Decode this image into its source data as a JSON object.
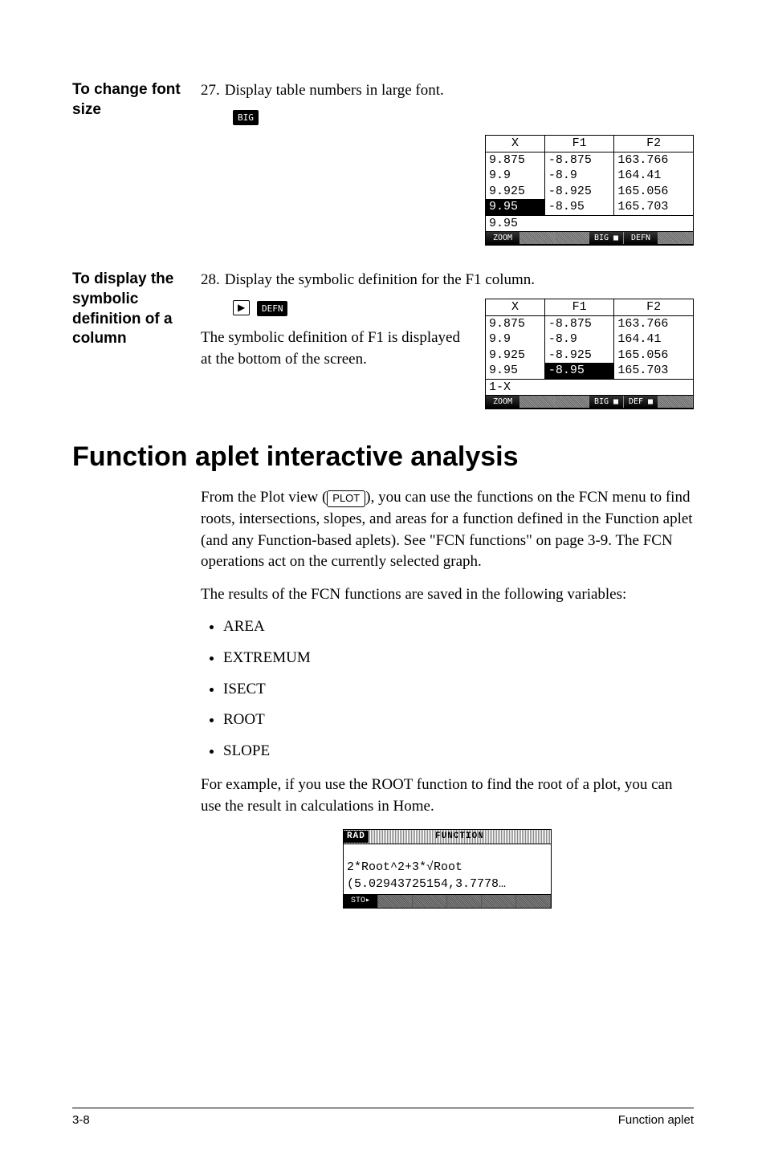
{
  "section1": {
    "heading": "To change font size",
    "step_num": "27.",
    "step_text": "Display table numbers in large font.",
    "softkey": "BIG",
    "table": {
      "headers": [
        "X",
        "F1",
        "F2"
      ],
      "rows": [
        [
          "9.875",
          "-8.875",
          "163.766"
        ],
        [
          "9.9",
          "-8.9",
          "164.41"
        ],
        [
          "9.925",
          "-8.925",
          "165.056"
        ],
        [
          "9.95",
          "-8.95",
          "165.703"
        ]
      ],
      "highlight_row": 3,
      "highlight_col": 0,
      "input_row": "9.95",
      "softkeys": [
        "ZOOM",
        "",
        "",
        "BIG ■",
        "DEFN",
        ""
      ]
    }
  },
  "section2": {
    "heading": "To display the symbolic definition of a column",
    "step_num": "28.",
    "step_text": "Display the symbolic definition for the F1 column.",
    "arrow": "▶",
    "softkey": "DEFN",
    "note": "The symbolic definition of F1 is displayed at the bottom of the screen.",
    "table": {
      "headers": [
        "X",
        "F1",
        "F2"
      ],
      "rows": [
        [
          "9.875",
          "-8.875",
          "163.766"
        ],
        [
          "9.9",
          "-8.9",
          "164.41"
        ],
        [
          "9.925",
          "-8.925",
          "165.056"
        ],
        [
          "9.95",
          "-8.95",
          "165.703"
        ]
      ],
      "highlight_row": 3,
      "highlight_col": 1,
      "input_row": "1-X",
      "softkeys": [
        "ZOOM",
        "",
        "",
        "BIG ■",
        "DEF ■",
        ""
      ]
    }
  },
  "main_heading": "Function aplet interactive analysis",
  "para1_a": "From the Plot view (",
  "para1_key": "PLOT",
  "para1_b": "), you can use the functions on the FCN menu to find roots, intersections, slopes, and areas for a function defined in the Function aplet (and any Function-based aplets). See \"FCN functions\" on page 3-9. The FCN operations act on the currently selected graph.",
  "para2": "The results of the FCN functions are saved in the following variables:",
  "vars": [
    "AREA",
    "EXTREMUM",
    "ISECT",
    "ROOT",
    "SLOPE"
  ],
  "para3": "For example, if you use the ROOT function to find the root of a plot, you can use the result in calculations in Home.",
  "home": {
    "rad": "RAD",
    "title": "FUNCTION",
    "line1": "2*Root^2+3*√Root",
    "line2": "(5.02943725154,3.7778…",
    "softkeys": [
      "STO▸",
      "",
      "",
      "",
      "",
      ""
    ]
  },
  "footer": {
    "page": "3-8",
    "title": "Function aplet"
  }
}
